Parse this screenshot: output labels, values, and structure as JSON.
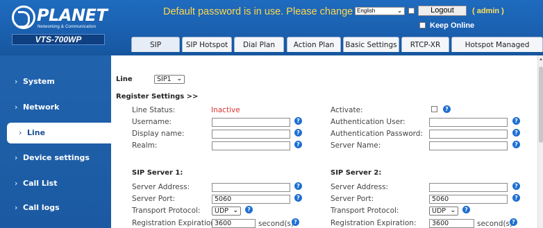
{
  "header": {
    "logo_name": "PLANET",
    "logo_sub": "Networking & Communication",
    "model": "VTS-700WP",
    "banner": "Default password is in use. Please change",
    "language": "English",
    "logout_label": "Logout",
    "user": "( admin )",
    "keep_online_label": "Keep Online"
  },
  "tabs": [
    {
      "label": "SIP"
    },
    {
      "label": "SIP Hotspot"
    },
    {
      "label": "Dial Plan"
    },
    {
      "label": "Action Plan"
    },
    {
      "label": "Basic Settings"
    },
    {
      "label": "RTCP-XR"
    },
    {
      "label": "Hotspot Managed Extension"
    }
  ],
  "sidebar": {
    "items": [
      {
        "label": "System"
      },
      {
        "label": "Network"
      },
      {
        "label": "Line"
      },
      {
        "label": "Device settings"
      },
      {
        "label": "Call List"
      },
      {
        "label": "Call logs"
      }
    ]
  },
  "main": {
    "line_label": "Line",
    "line_value": "SIP1",
    "register_title": "Register Settings >>",
    "line_status_label": "Line Status:",
    "line_status_value": "Inactive",
    "activate_label": "Activate:",
    "username_label": "Username:",
    "auth_user_label": "Authentication User:",
    "display_name_label": "Display name:",
    "auth_password_label": "Authentication Password:",
    "realm_label": "Realm:",
    "server_name_label": "Server Name:",
    "server1": {
      "title": "SIP Server 1:",
      "address_label": "Server Address:",
      "port_label": "Server Port:",
      "port_value": "5060",
      "transport_label": "Transport Protocol:",
      "transport_value": "UDP",
      "expiration_label": "Registration Expiration:",
      "expiration_value": "3600",
      "expiration_unit": "second(s)"
    },
    "server2": {
      "title": "SIP Server 2:",
      "address_label": "Server Address:",
      "port_label": "Server Port:",
      "port_value": "5060",
      "transport_label": "Transport Protocol:",
      "transport_value": "UDP",
      "expiration_label": "Registration Expiration:",
      "expiration_value": "3600",
      "expiration_unit": "second(s)"
    },
    "help_glyph": "?"
  },
  "colors": {
    "header_blue": "#1a5fae",
    "banner_yellow": "#ffd84a",
    "inactive_red": "#dd3333",
    "help_blue": "#1f6fd0"
  }
}
